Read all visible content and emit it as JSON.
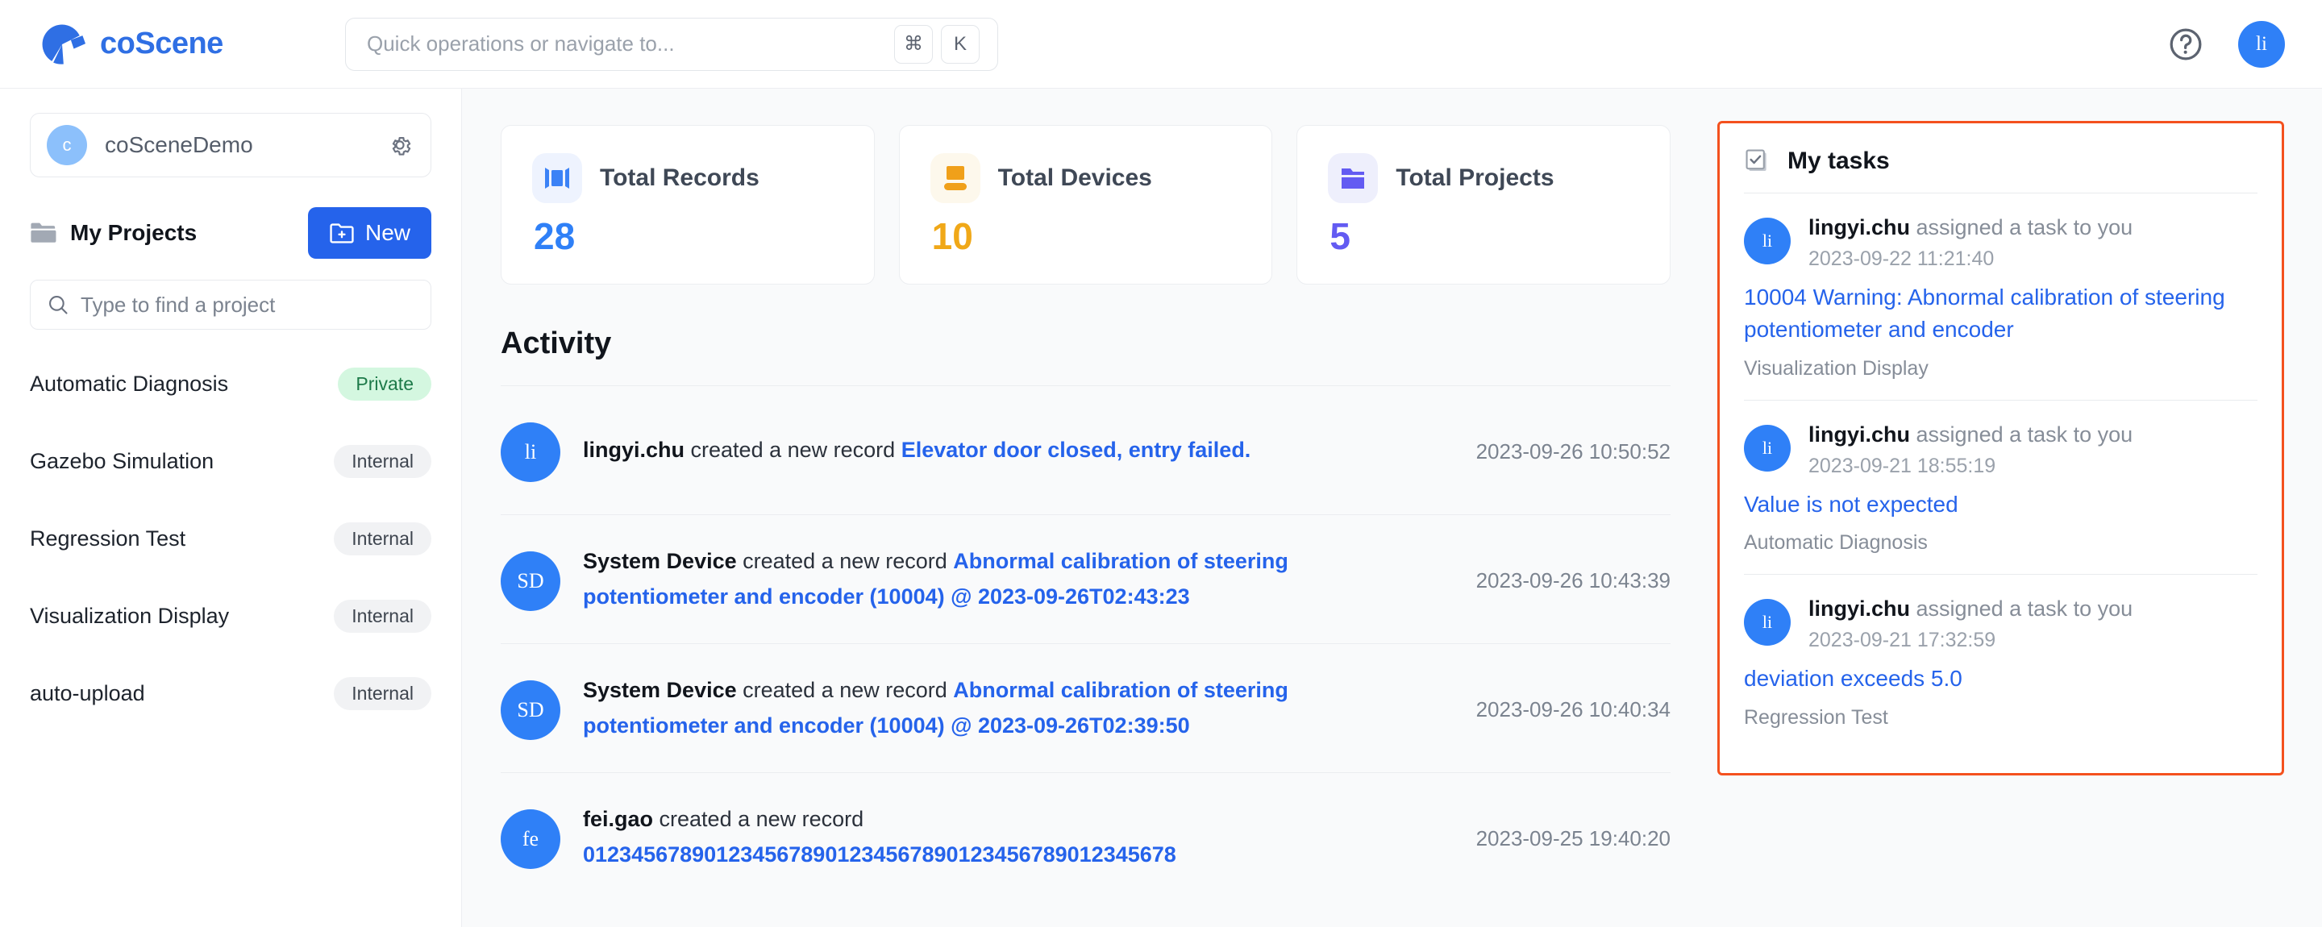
{
  "app": {
    "brand_name": "coScene",
    "logo_icon": "aperture-logo-icon"
  },
  "search": {
    "placeholder": "Quick operations or navigate to...",
    "shortcut_key_1": "⌘",
    "shortcut_key_2": "K"
  },
  "topbar": {
    "help_icon": "question-circle-icon",
    "avatar_initials": "li"
  },
  "sidebar": {
    "org": {
      "avatar_initial": "c",
      "name": "coSceneDemo",
      "settings_icon": "gear-icon"
    },
    "projects_header": {
      "icon": "folder-icon",
      "label": "My Projects",
      "new_button_label": "New",
      "new_button_icon": "new-folder-icon"
    },
    "project_search": {
      "icon": "search-icon",
      "placeholder": "Type to find a project"
    },
    "projects": [
      {
        "name": "Automatic Diagnosis",
        "visibility": "Private",
        "visibility_type": "private"
      },
      {
        "name": "Gazebo Simulation",
        "visibility": "Internal",
        "visibility_type": "internal"
      },
      {
        "name": "Regression Test",
        "visibility": "Internal",
        "visibility_type": "internal"
      },
      {
        "name": "Visualization Display",
        "visibility": "Internal",
        "visibility_type": "internal"
      },
      {
        "name": "auto-upload",
        "visibility": "Internal",
        "visibility_type": "internal"
      }
    ]
  },
  "main": {
    "stats": [
      {
        "title": "Total Records",
        "value": "28",
        "icon": "records-icon"
      },
      {
        "title": "Total Devices",
        "value": "10",
        "icon": "device-icon"
      },
      {
        "title": "Total Projects",
        "value": "5",
        "icon": "projects-folder-icon"
      }
    ],
    "activity_title": "Activity",
    "activities": [
      {
        "avatar": "li",
        "user": "lingyi.chu",
        "verb": "created a new record",
        "link": "Elevator door closed, entry failed.",
        "time": "2023-09-26 10:50:52"
      },
      {
        "avatar": "SD",
        "user": "System Device",
        "verb": "created a new record",
        "link": "Abnormal calibration of steering potentiometer and encoder (10004) @ 2023-09-26T02:43:23",
        "time": "2023-09-26 10:43:39"
      },
      {
        "avatar": "SD",
        "user": "System Device",
        "verb": "created a new record",
        "link": "Abnormal calibration of steering potentiometer and encoder (10004) @ 2023-09-26T02:39:50",
        "time": "2023-09-26 10:40:34"
      },
      {
        "avatar": "fe",
        "user": "fei.gao",
        "verb": "created a new record",
        "link": "0123456789012345678901234567890123456789012345678",
        "time": "2023-09-25 19:40:20"
      }
    ]
  },
  "tasks": {
    "icon": "checklist-icon",
    "title": "My tasks",
    "highlight_color": "#f4511e",
    "items": [
      {
        "avatar": "li",
        "user": "lingyi.chu",
        "action": "assigned a task to you",
        "time": "2023-09-22 11:21:40",
        "title": "10004 Warning: Abnormal calibration of steering potentiometer and encoder",
        "project": "Visualization Display"
      },
      {
        "avatar": "li",
        "user": "lingyi.chu",
        "action": "assigned a task to you",
        "time": "2023-09-21 18:55:19",
        "title": "Value is not expected",
        "project": "Automatic Diagnosis"
      },
      {
        "avatar": "li",
        "user": "lingyi.chu",
        "action": "assigned a task to you",
        "time": "2023-09-21 17:32:59",
        "title": "deviation exceeds 5.0",
        "project": "Regression Test"
      }
    ]
  },
  "colors": {
    "brand_blue": "#2f6fe4",
    "primary_blue": "#2563eb",
    "link_blue": "#2563eb",
    "amber": "#f0a818",
    "indigo": "#635bf2",
    "highlight_orange": "#f4511e",
    "private_badge_bg": "#d4f7e0",
    "internal_badge_bg": "#f1f2f4"
  }
}
